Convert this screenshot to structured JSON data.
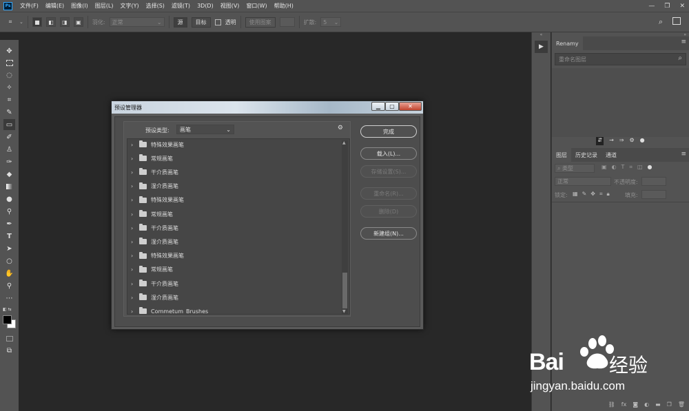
{
  "app": {
    "logo_text": "Ps"
  },
  "menu": [
    "文件(F)",
    "编辑(E)",
    "图像(I)",
    "图层(L)",
    "文字(Y)",
    "选择(S)",
    "滤镜(T)",
    "3D(D)",
    "视图(V)",
    "窗口(W)",
    "帮助(H)"
  ],
  "window_controls": {
    "minimize": "—",
    "restore": "❐",
    "close": "✕"
  },
  "options_bar": {
    "feather_label": "羽化:",
    "mode_value": "正常",
    "source_label": "源",
    "target_label": "目标",
    "transparent_label": "透明",
    "use_pattern_label": "使用图案",
    "diffuse_label": "扩散:",
    "diffuse_value": "5"
  },
  "renamy_panel": {
    "tab": "Renamy",
    "search_placeholder": "重命名图层"
  },
  "layers_panel": {
    "tabs": [
      "图层",
      "历史记录",
      "通道"
    ],
    "filter_label": "类型",
    "blend_mode": "正常",
    "opacity_label": "不透明度:",
    "lock_label": "锁定:",
    "fill_label": "填充:",
    "footer_icons": [
      "link-icon",
      "fx-icon",
      "mask-icon",
      "adjustment-icon",
      "group-icon",
      "new-layer-icon",
      "trash-icon"
    ]
  },
  "dialog": {
    "title": "预设管理器",
    "preset_type_label": "预设类型:",
    "preset_type_value": "画笔",
    "items": [
      "特殊效果画笔",
      "常规画笔",
      "干介质画笔",
      "湿介质画笔",
      "特殊效果画笔",
      "常规画笔",
      "干介质画笔",
      "湿介质画笔",
      "特殊效果画笔",
      "常规画笔",
      "干介质画笔",
      "湿介质画笔",
      "Commetum_Brushes"
    ],
    "buttons": {
      "done": "完成",
      "load": "载入(L)...",
      "save_set": "存储设置(S)...",
      "rename": "重命名(R)...",
      "delete": "删除(D)",
      "new_group": "新建组(N)..."
    }
  },
  "watermark": {
    "brand": "Bai",
    "brand_suffix": "经验",
    "url": "jingyan.baidu.com"
  }
}
